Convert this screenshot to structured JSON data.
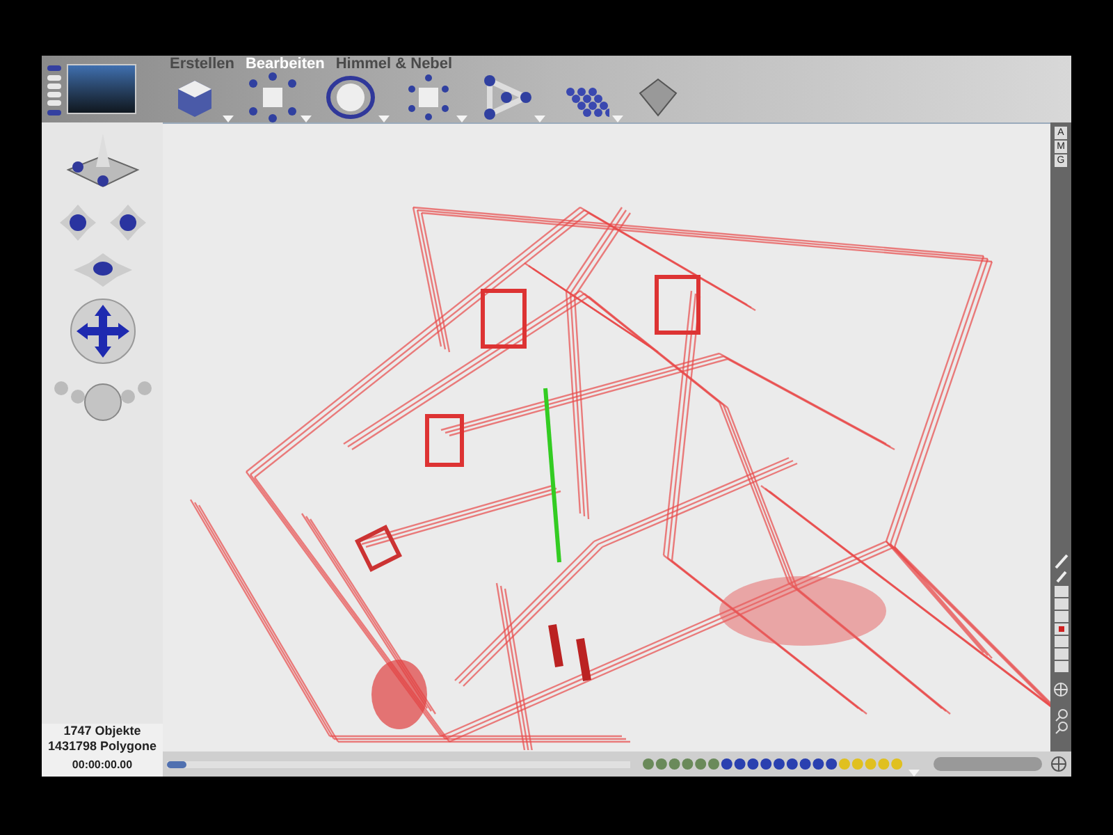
{
  "menu_tabs": [
    {
      "label": "Erstellen",
      "selected": false
    },
    {
      "label": "Bearbeiten",
      "selected": true
    },
    {
      "label": "Himmel & Nebel",
      "selected": false
    }
  ],
  "view_letters": [
    "A",
    "M",
    "G"
  ],
  "timeline": {
    "level": 0
  },
  "status": {
    "objects": "1747 Objekte",
    "polygons": "1431798 Polygone",
    "time": "00:00:00.00"
  }
}
